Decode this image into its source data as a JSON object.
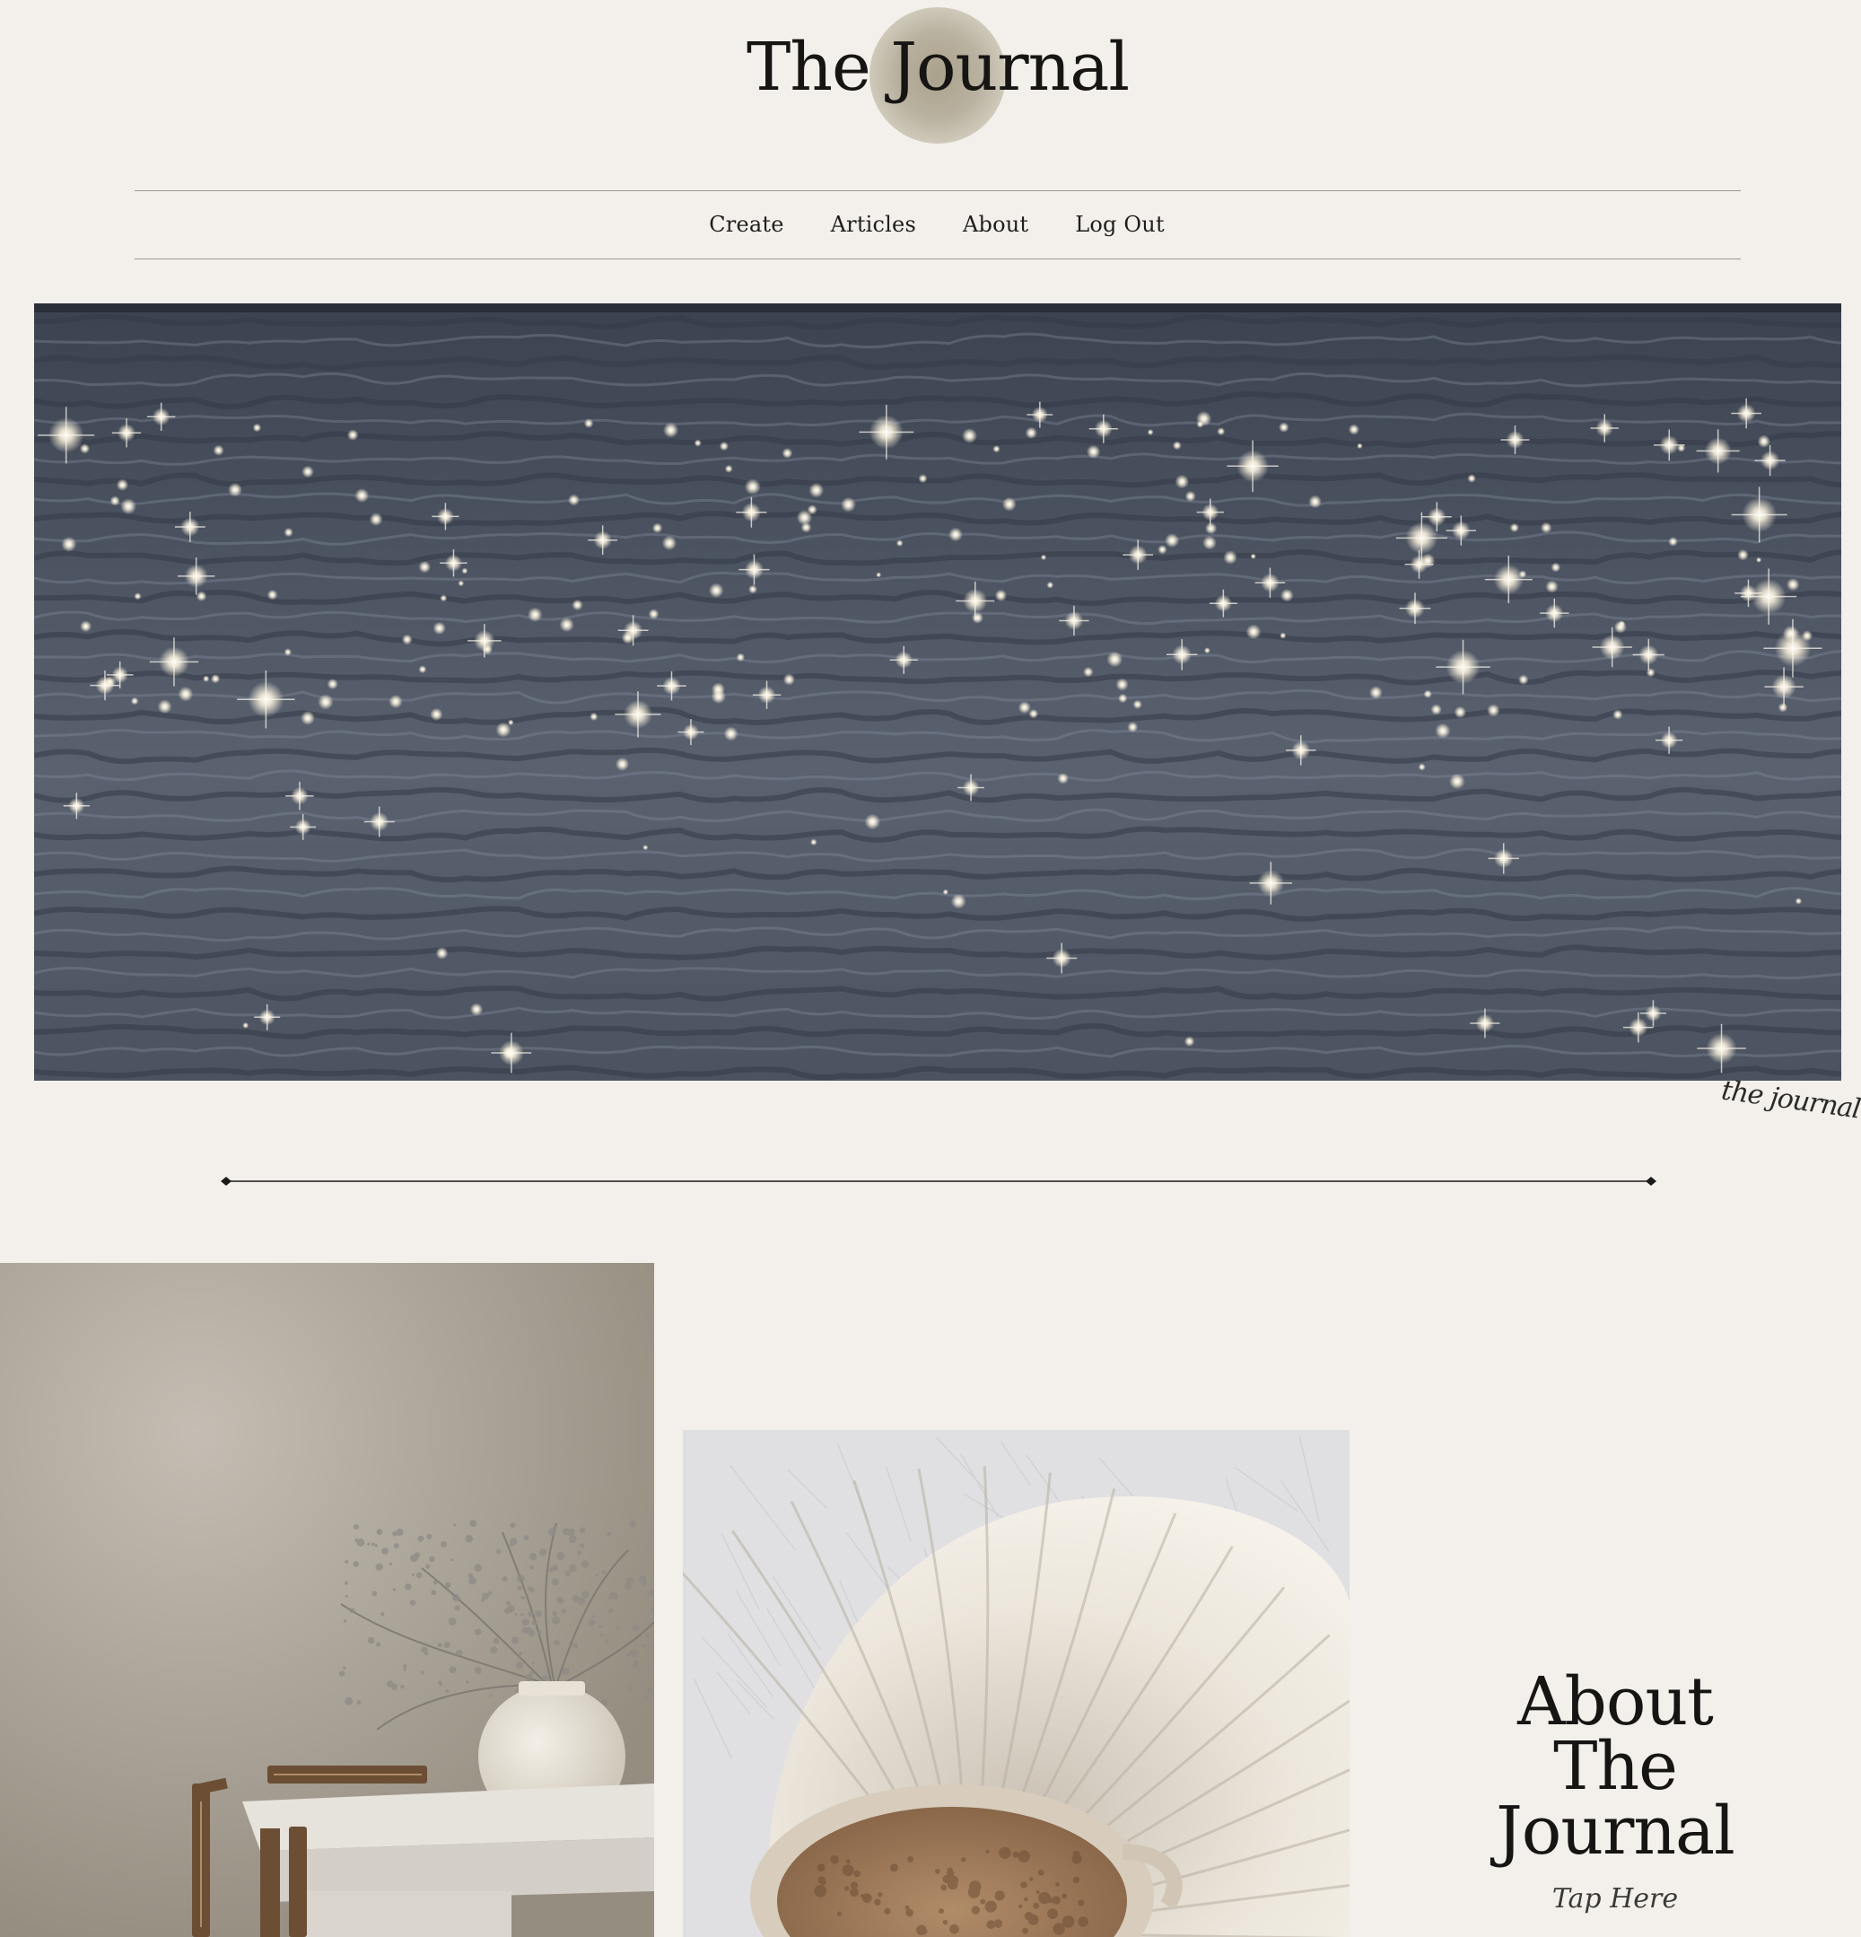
{
  "site": {
    "title": "The Journal"
  },
  "nav": {
    "items": [
      {
        "label": "Create"
      },
      {
        "label": "Articles"
      },
      {
        "label": "About"
      },
      {
        "label": "Log Out"
      }
    ]
  },
  "hero": {
    "image_alt": "sunlight sparkling on ocean water",
    "signature": "the journal"
  },
  "about": {
    "title_line1": "About",
    "title_line2": "The",
    "title_line3": "Journal",
    "cta": "Tap Here"
  },
  "colors": {
    "background": "#f3f0eb",
    "accent_disc": "#b1a994",
    "text": "#161513",
    "rule": "#9a978f"
  }
}
